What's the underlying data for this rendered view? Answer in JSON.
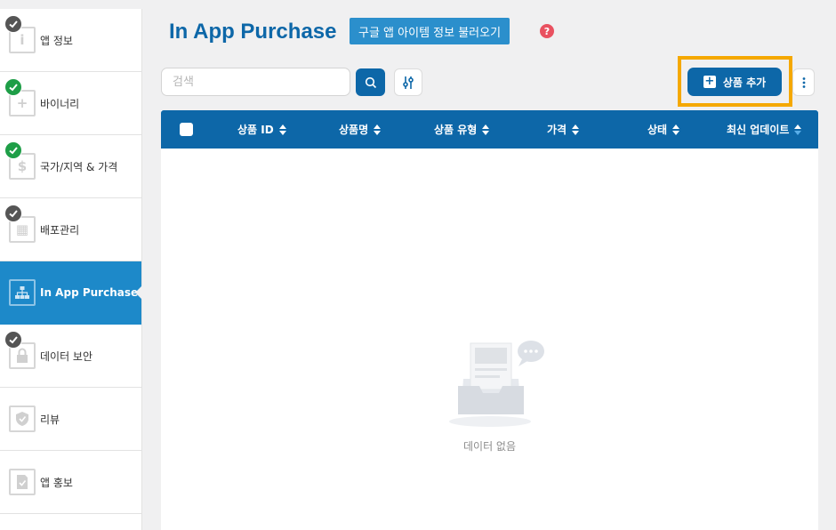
{
  "sidebar": {
    "items": [
      {
        "label": "앱 정보",
        "icon": "info-icon",
        "glyph": "i",
        "status": "gray",
        "active": false
      },
      {
        "label": "바이너리",
        "icon": "binary-icon",
        "glyph": "+",
        "status": "green",
        "active": false
      },
      {
        "label": "국가/지역 & 가격",
        "icon": "dollar-icon",
        "glyph": "$",
        "status": "green",
        "active": false
      },
      {
        "label": "배포관리",
        "icon": "calendar-icon",
        "glyph": "▦",
        "status": "gray",
        "active": false
      },
      {
        "label": "In App Purchase",
        "icon": "hierarchy-icon",
        "glyph": "⛬",
        "status": "none",
        "active": true
      },
      {
        "label": "데이터 보안",
        "icon": "lock-icon",
        "glyph": "🔒",
        "status": "gray",
        "active": false
      },
      {
        "label": "리뷰",
        "icon": "shield-icon",
        "glyph": "✓",
        "status": "none",
        "active": false
      },
      {
        "label": "앱 홍보",
        "icon": "document-icon",
        "glyph": "✓",
        "status": "none",
        "active": false
      }
    ]
  },
  "header": {
    "title": "In App Purchase",
    "load_button": "구글 앱 아이템 정보 불러오기",
    "help": "?"
  },
  "toolbar": {
    "search_placeholder": "검색",
    "add_button": "상품 추가"
  },
  "table": {
    "columns": [
      "상품 ID",
      "상품명",
      "상품 유형",
      "가격",
      "상태",
      "최신 업데이트"
    ],
    "empty_text": "데이터 없음"
  },
  "colors": {
    "primary": "#0d67a8",
    "sidebar_active": "#1d89c9",
    "highlight": "#f5a800",
    "help": "#e95160",
    "check_green": "#1e9e47",
    "check_gray": "#555555"
  }
}
